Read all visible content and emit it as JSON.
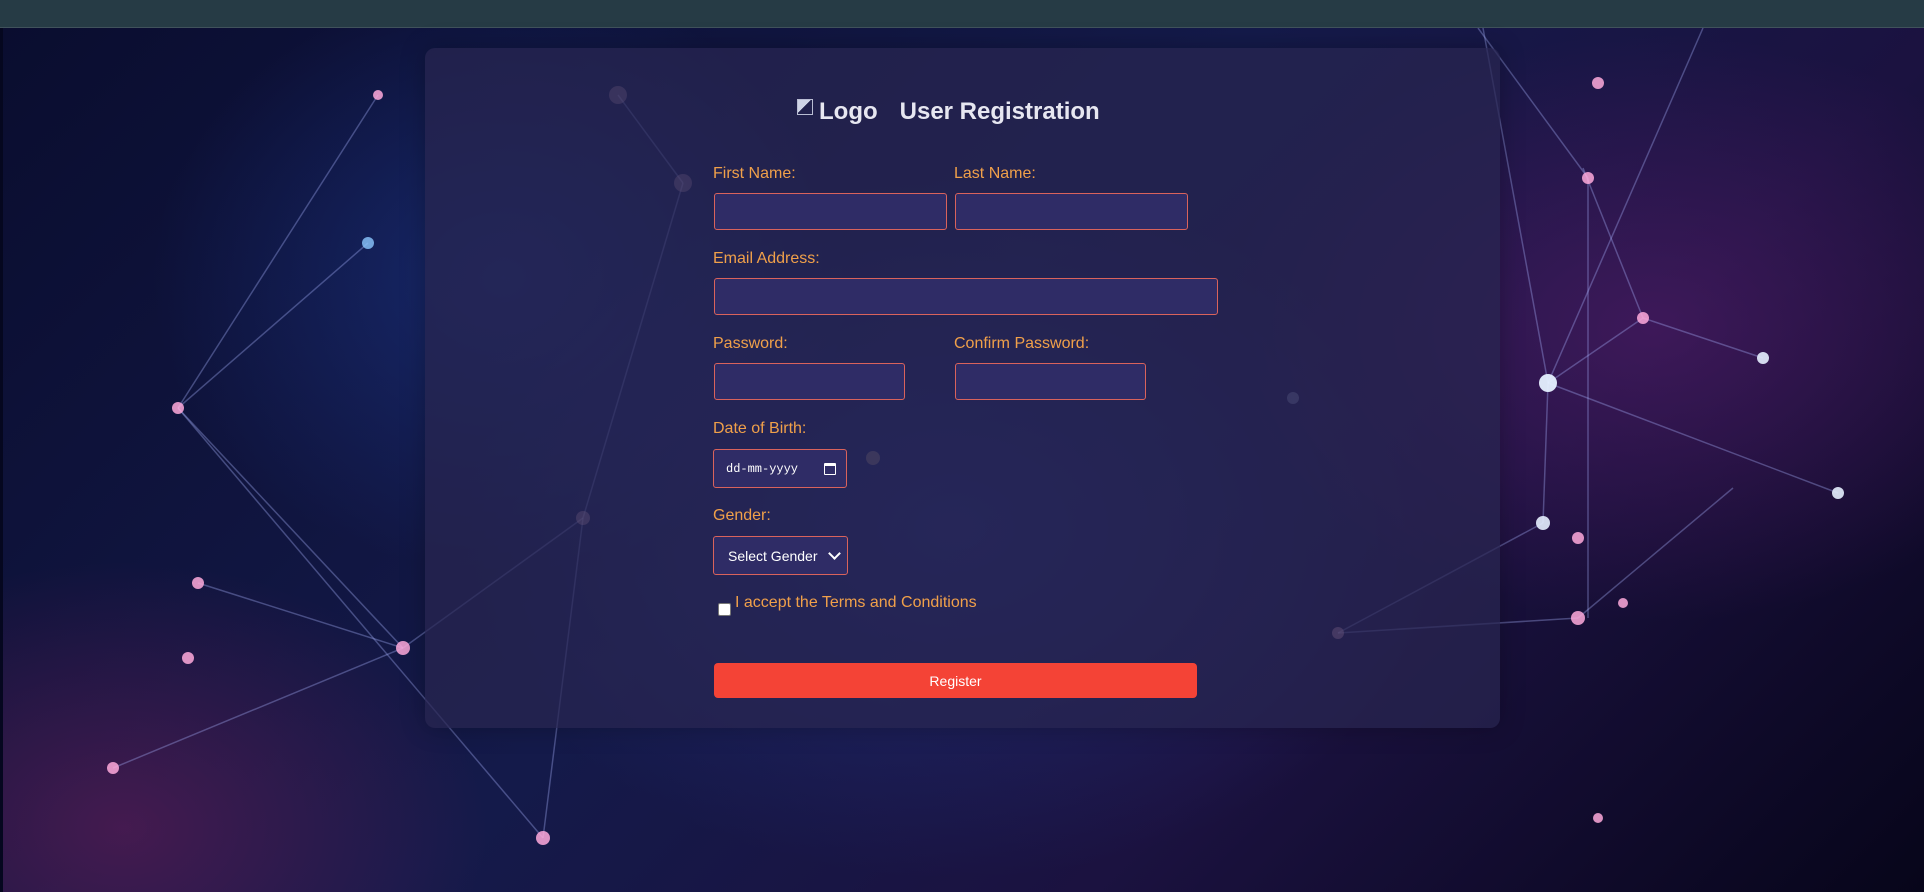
{
  "header": {
    "logo_alt": "Logo",
    "title": "User Registration"
  },
  "form": {
    "first_name_label": "First Name:",
    "last_name_label": "Last Name:",
    "email_label": "Email Address:",
    "password_label": "Password:",
    "confirm_password_label": "Confirm Password:",
    "dob_label": "Date of Birth:",
    "dob_placeholder": "dd-mm-yyyy",
    "gender_label": "Gender:",
    "gender_selected": "Select Gender",
    "terms_label": "I accept the Terms and Conditions",
    "register_label": "Register"
  },
  "colors": {
    "label": "#f0a04a",
    "input_border": "#d9635c",
    "button": "#f44336"
  }
}
